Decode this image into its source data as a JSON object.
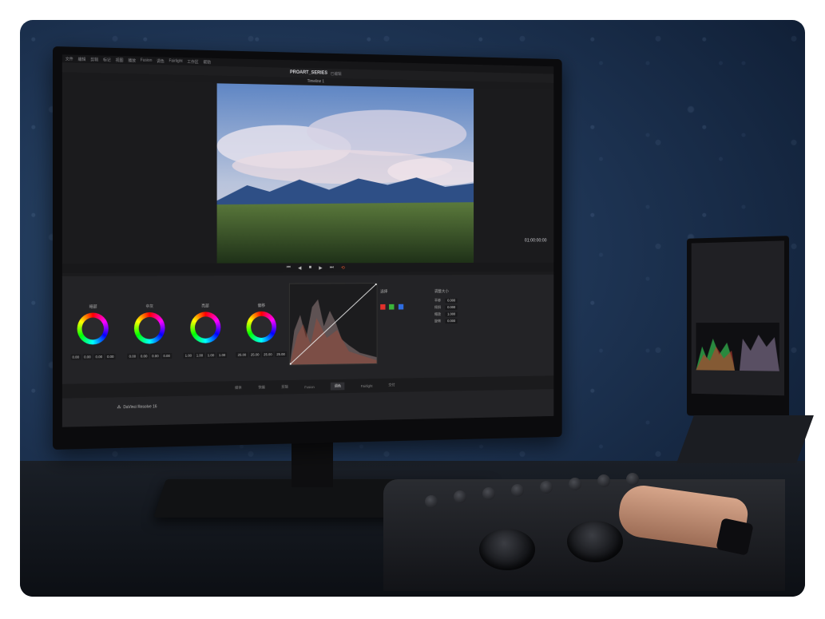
{
  "app": {
    "menu": [
      "文件",
      "编辑",
      "剪辑",
      "标记",
      "视图",
      "播放",
      "Fusion",
      "调色",
      "Fairlight",
      "工作区",
      "帮助"
    ],
    "project_title": "PROART_SERIES",
    "edited_label": "已编辑",
    "timeline_name": "Timeline 1",
    "timecode": "01:00:00:00",
    "wheel_labels": [
      "暗部",
      "中灰",
      "亮部",
      "偏移"
    ],
    "wheel_values": [
      [
        "0.00",
        "0.00",
        "0.00",
        "0.00"
      ],
      [
        "0.00",
        "0.00",
        "0.00",
        "0.00"
      ],
      [
        "1.00",
        "1.00",
        "1.00",
        "1.00"
      ],
      [
        "25.00",
        "25.00",
        "25.00",
        "25.00"
      ]
    ],
    "curves_label": "曲线",
    "qualifier_label": "选择",
    "sizing_label": "调整大小",
    "sizing_rows": [
      {
        "label": "平移",
        "value": "0.000"
      },
      {
        "label": "倾斜",
        "value": "0.000"
      },
      {
        "label": "缩放",
        "value": "1.000"
      },
      {
        "label": "旋转",
        "value": "0.000"
      }
    ],
    "tabs": [
      "媒体",
      "快编",
      "剪辑",
      "Fusion",
      "调色",
      "Fairlight",
      "交付"
    ],
    "active_tab": "调色",
    "product": "DaVinci Resolve 16"
  },
  "colors": {
    "ui_bg": "#1b1b1d",
    "panel_bg": "#232326",
    "wall": "#1d3352"
  }
}
